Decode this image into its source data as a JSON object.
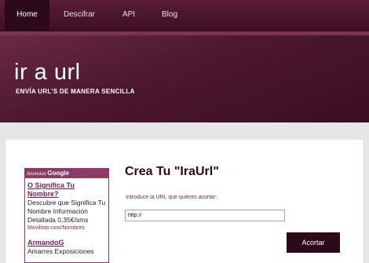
{
  "nav": {
    "items": [
      {
        "label": "Home",
        "active": true
      },
      {
        "label": "Descifrar",
        "active": false
      },
      {
        "label": "API",
        "active": false
      },
      {
        "label": "Blog",
        "active": false
      }
    ]
  },
  "header": {
    "title": "ir a url",
    "tagline": "ENVÍA URL'S DE MANERA SENCILLA"
  },
  "ad": {
    "header_prefix": "Anuncios",
    "header_brand": "Google",
    "items": [
      {
        "title": "O Significa Tu Nombre?",
        "description": "Descubre que Significa Tu Nombre Información Detallada 0,35€/sms",
        "url": "Movilisto.com/Nombres"
      },
      {
        "title": "ArmandoG",
        "description": "Amarres Exposiciones"
      }
    ]
  },
  "form": {
    "title": "Crea Tu \"IraUrl\"",
    "label": "Introduce la URL que quieres acortar:",
    "input_value": "http://",
    "submit_label": "Acortar"
  },
  "colors": {
    "brand_dark": "#2c0a19",
    "brand": "#4d1730",
    "accent": "#8e3a66"
  }
}
